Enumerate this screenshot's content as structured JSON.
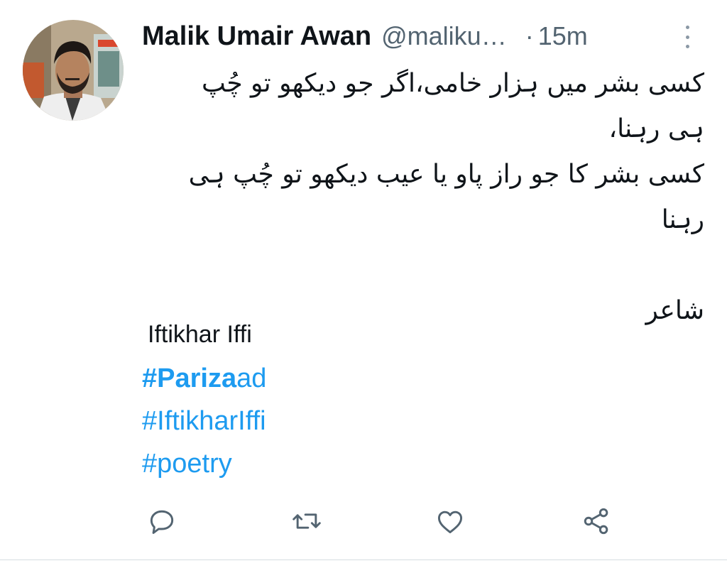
{
  "tweet": {
    "author_name": "Malik Umair Awan",
    "handle": "@maliku…",
    "separator": "·",
    "time": "15m",
    "urdu_lines": [
      "کسی بشر میں ہزار خامی،اگر جو دیکھو تو چُپ",
      "ہی رہنا،",
      "کسی بشر کا جو راز پاو یا عیب دیکھو تو چُپ ہی",
      "رہنا"
    ],
    "poet_label": "شاعر",
    "poet_name": "Iftikhar Iffi",
    "hashtag1_bold": "#Pariza",
    "hashtag1_rest": "ad",
    "hashtag2": "#IftikharIffi",
    "hashtag3": "#poetry"
  },
  "actions": {
    "reply": "reply-icon",
    "retweet": "retweet-icon",
    "like": "heart-icon",
    "share": "share-icon"
  },
  "colors": {
    "text": "#0f1419",
    "secondary": "#536471",
    "link": "#1d9bf0",
    "icon": "#536471"
  }
}
